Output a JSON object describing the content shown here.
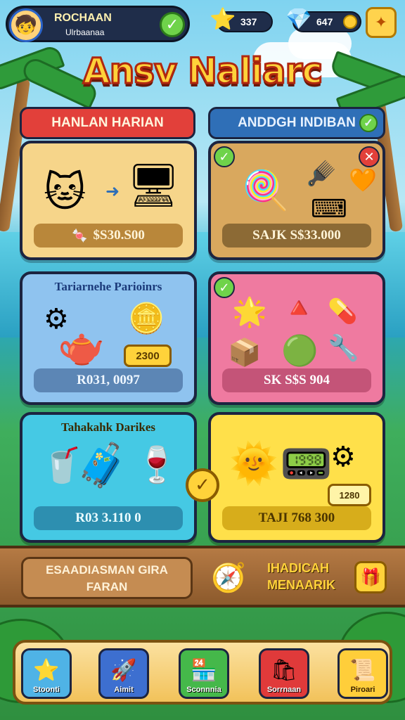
{
  "profile": {
    "name": "ROCHAAN",
    "subtitle": "Ulrbaanaa"
  },
  "resources": {
    "stars": "337",
    "gems": "647"
  },
  "title": "Ansv Naliarc",
  "sections": {
    "left": "HANLAN HARIAN",
    "right": "ANDDGH INDIBAN"
  },
  "cards": [
    {
      "caption": "",
      "price": "$S30.S00"
    },
    {
      "caption": "",
      "price": "SAJK S$33.000"
    },
    {
      "caption": "Tariarnehe Parioinrs",
      "price": "R031, 0097",
      "tag": "2300"
    },
    {
      "caption": "",
      "price": "SK S$S 904"
    },
    {
      "caption": "Tahakahk Darikes",
      "price": "R03 3.110 0"
    },
    {
      "caption": "",
      "price": "TAJI 768 300",
      "tag": "1280"
    }
  ],
  "banner": {
    "left_line1": "ESAADIASMAN GIRA",
    "left_line2": "FARAN",
    "right_line1": "IHADICAH",
    "right_line2": "MENAARIK"
  },
  "nav": [
    {
      "label": "Stoonti",
      "icon": "star-icon"
    },
    {
      "label": "Aimit",
      "icon": "rocket-icon"
    },
    {
      "label": "Sconnnia",
      "icon": "shop-icon"
    },
    {
      "label": "Sorrnaan",
      "icon": "bag-icon"
    },
    {
      "label": "Piroari",
      "icon": "scroll-icon"
    }
  ],
  "colors": {
    "title": "#ffd23a",
    "accent_red": "#e2403a",
    "accent_blue": "#2f6fb7",
    "wood": "#8c5a2c"
  }
}
